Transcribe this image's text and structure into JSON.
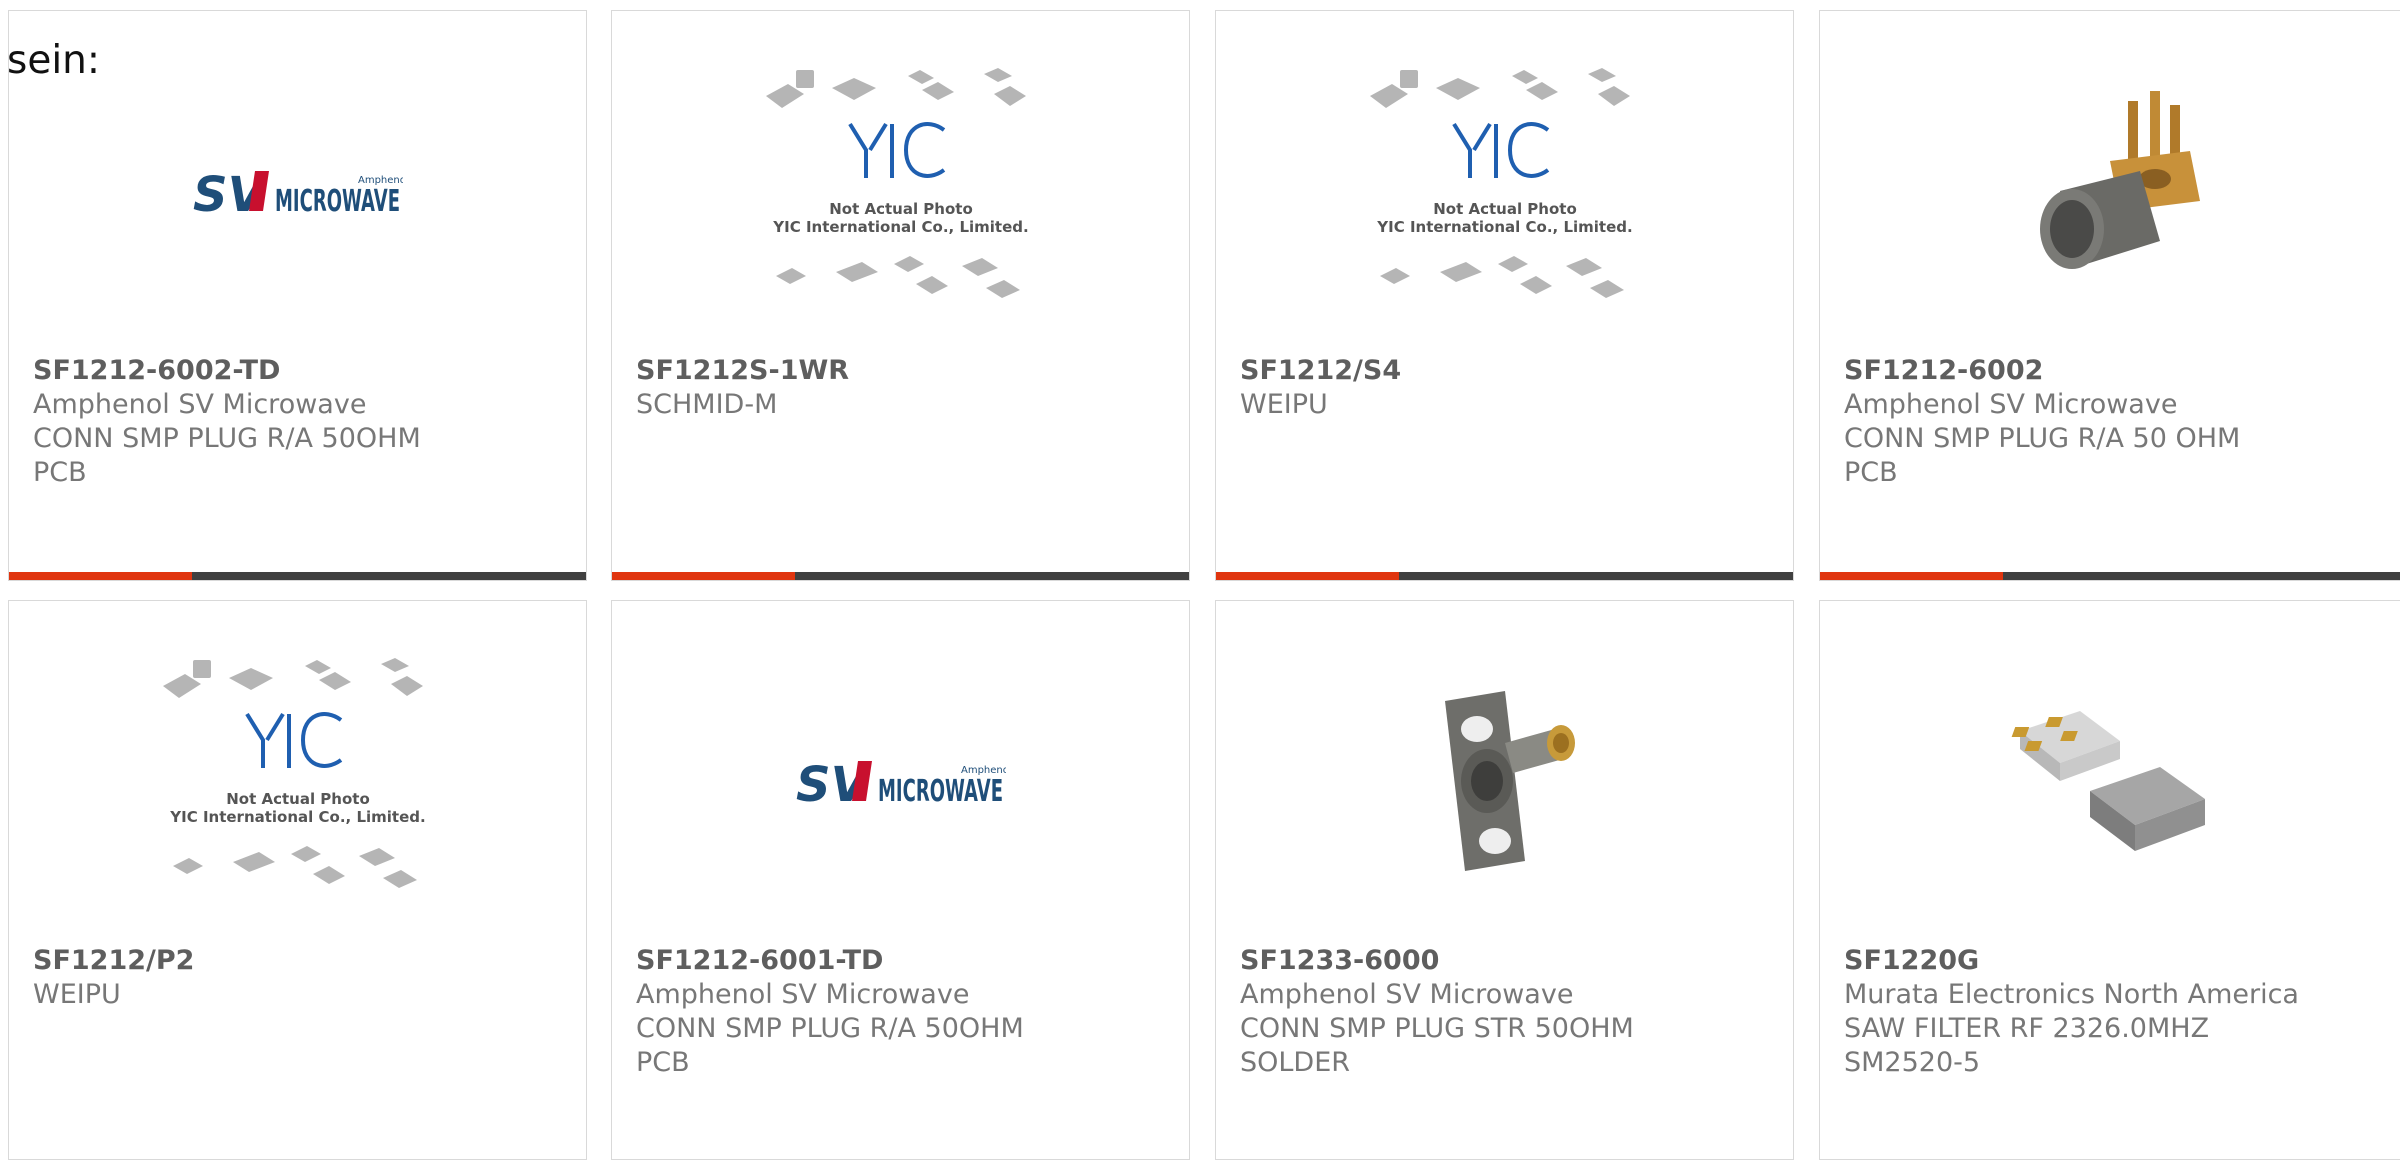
{
  "intro_text": "sein:",
  "colors": {
    "accent": "#e0350f",
    "bar_dark": "#404040",
    "border": "#d9d9d9",
    "sv_blue": "#1f4e79",
    "sv_red": "#c8102e",
    "yic_blue": "#1f5fb0"
  },
  "logos": {
    "sv": {
      "big": "SV",
      "word": "MICROWAVE",
      "small": "Amphenol"
    },
    "yic": {
      "letters": "YIC",
      "line1": "Not Actual Photo",
      "line2": "YIC International Co., Limited."
    }
  },
  "products": [
    {
      "part": "SF1212-6002-TD",
      "lines": [
        "Amphenol SV Microwave",
        "CONN SMP PLUG R/A 50OHM",
        "PCB"
      ],
      "image": "sv-microwave-logo"
    },
    {
      "part": "SF1212S-1WR",
      "lines": [
        "SCHMID-M"
      ],
      "image": "yic-placeholder"
    },
    {
      "part": "SF1212/S4",
      "lines": [
        "WEIPU"
      ],
      "image": "yic-placeholder"
    },
    {
      "part": "SF1212-6002",
      "lines": [
        "Amphenol SV Microwave",
        "CONN SMP PLUG R/A 50 OHM",
        "PCB"
      ],
      "image": "smp-right-angle-connector"
    },
    {
      "part": "SF1212/P2",
      "lines": [
        "WEIPU"
      ],
      "image": "yic-placeholder"
    },
    {
      "part": "SF1212-6001-TD",
      "lines": [
        "Amphenol SV Microwave",
        "CONN SMP PLUG R/A 50OHM",
        "PCB"
      ],
      "image": "sv-microwave-logo"
    },
    {
      "part": "SF1233-6000",
      "lines": [
        "Amphenol SV Microwave",
        "CONN SMP PLUG STR 50OHM",
        "SOLDER"
      ],
      "image": "smp-flange-connector"
    },
    {
      "part": "SF1220G",
      "lines": [
        "Murata Electronics North America",
        "SAW FILTER RF 2326.0MHZ",
        "SM2520-5"
      ],
      "image": "saw-filter-chip"
    }
  ]
}
